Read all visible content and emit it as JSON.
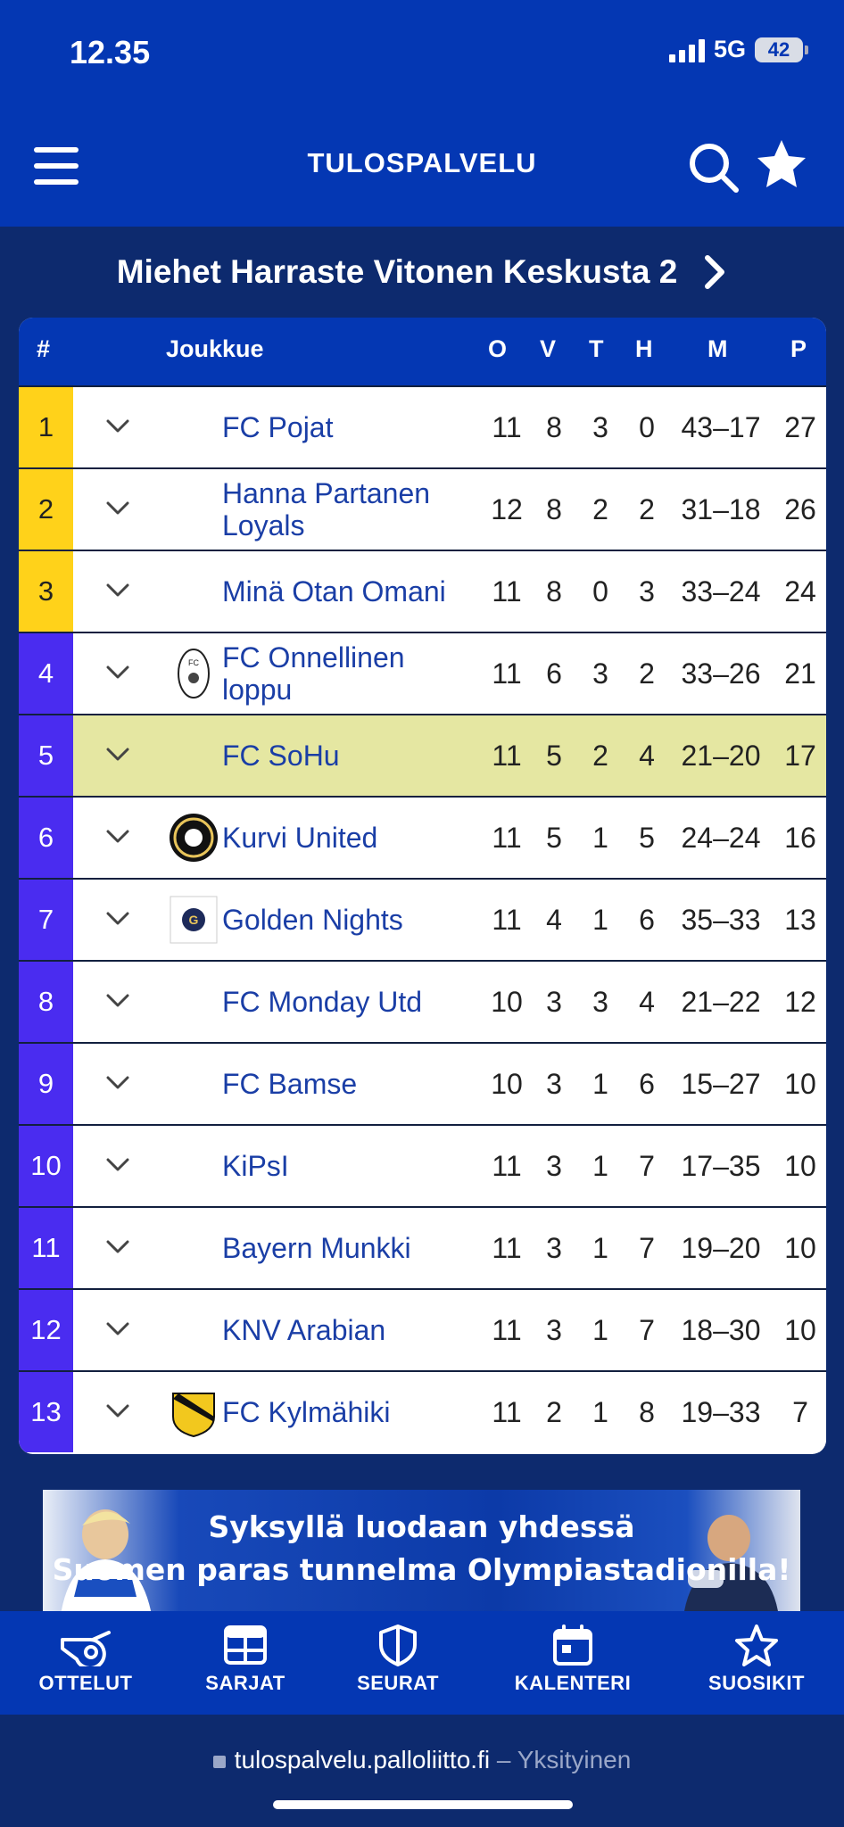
{
  "status": {
    "time": "12.35",
    "network": "5G",
    "battery": "42"
  },
  "header": {
    "title": "TULOSPALVELU"
  },
  "league": {
    "name": "Miehet Harraste Vitonen Keskusta 2"
  },
  "table": {
    "headers": {
      "rank": "#",
      "team": "Joukkue",
      "o": "O",
      "v": "V",
      "t": "T",
      "h": "H",
      "m": "M",
      "p": "P"
    },
    "rows": [
      {
        "rank": "1",
        "team": "FC Pojat",
        "o": "11",
        "v": "8",
        "t": "3",
        "h": "0",
        "m": "43–17",
        "p": "27"
      },
      {
        "rank": "2",
        "team": "Hanna Partanen Loyals",
        "o": "12",
        "v": "8",
        "t": "2",
        "h": "2",
        "m": "31–18",
        "p": "26"
      },
      {
        "rank": "3",
        "team": "Minä Otan Omani",
        "o": "11",
        "v": "8",
        "t": "0",
        "h": "3",
        "m": "33–24",
        "p": "24"
      },
      {
        "rank": "4",
        "team": "FC Onnellinen loppu",
        "o": "11",
        "v": "6",
        "t": "3",
        "h": "2",
        "m": "33–26",
        "p": "21"
      },
      {
        "rank": "5",
        "team": "FC SoHu",
        "o": "11",
        "v": "5",
        "t": "2",
        "h": "4",
        "m": "21–20",
        "p": "17"
      },
      {
        "rank": "6",
        "team": "Kurvi United",
        "o": "11",
        "v": "5",
        "t": "1",
        "h": "5",
        "m": "24–24",
        "p": "16"
      },
      {
        "rank": "7",
        "team": "Golden Nights",
        "o": "11",
        "v": "4",
        "t": "1",
        "h": "6",
        "m": "35–33",
        "p": "13"
      },
      {
        "rank": "8",
        "team": "FC Monday Utd",
        "o": "10",
        "v": "3",
        "t": "3",
        "h": "4",
        "m": "21–22",
        "p": "12"
      },
      {
        "rank": "9",
        "team": "FC Bamse",
        "o": "10",
        "v": "3",
        "t": "1",
        "h": "6",
        "m": "15–27",
        "p": "10"
      },
      {
        "rank": "10",
        "team": "KiPsI",
        "o": "11",
        "v": "3",
        "t": "1",
        "h": "7",
        "m": "17–35",
        "p": "10"
      },
      {
        "rank": "11",
        "team": "Bayern Munkki",
        "o": "11",
        "v": "3",
        "t": "1",
        "h": "7",
        "m": "19–20",
        "p": "10"
      },
      {
        "rank": "12",
        "team": "KNV Arabian",
        "o": "11",
        "v": "3",
        "t": "1",
        "h": "7",
        "m": "18–30",
        "p": "10"
      },
      {
        "rank": "13",
        "team": "FC Kylmähiki",
        "o": "11",
        "v": "2",
        "t": "1",
        "h": "8",
        "m": "19–33",
        "p": "7"
      }
    ]
  },
  "banner": {
    "line1": "Syksyllä luodaan yhdessä",
    "line2": "Suomen paras tunnelma Olympiastadionilla!"
  },
  "tabs": [
    {
      "label": "OTTELUT",
      "icon": "whistle-icon"
    },
    {
      "label": "SARJAT",
      "icon": "table-icon"
    },
    {
      "label": "SEURAT",
      "icon": "shield-icon"
    },
    {
      "label": "KALENTERI",
      "icon": "calendar-icon"
    },
    {
      "label": "SUOSIKIT",
      "icon": "star-outline-icon"
    }
  ],
  "browser": {
    "url": "tulospalvelu.palloliitto.fi",
    "privacy": "– Yksityinen"
  },
  "colors": {
    "primary": "#0437b3",
    "dark": "#0d2a6e",
    "top3": "#ffd21a",
    "rank": "#4a2cf0",
    "highlight": "#e5e7a2",
    "team_link": "#1a3ea6"
  }
}
